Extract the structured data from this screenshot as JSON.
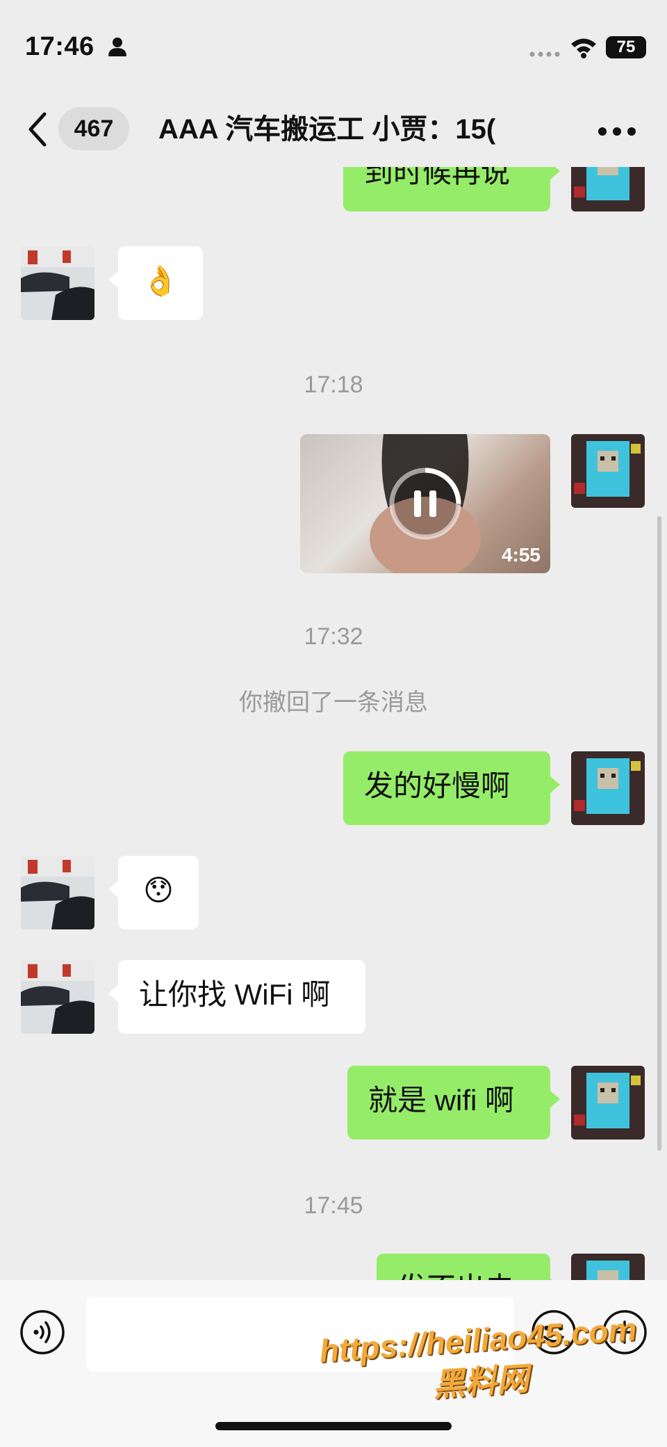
{
  "status_bar": {
    "time": "17:46",
    "battery": "75"
  },
  "nav": {
    "unread_count": "467",
    "title": "AAA 汽车搬运工 小贾：15("
  },
  "messages": {
    "m1_text": "到时候再说",
    "m2_emoji": "👌",
    "ts1": "17:18",
    "video_duration": "4:55",
    "ts2": "17:32",
    "recall_notice": "你撤回了一条消息",
    "m4_text": "发的好慢啊",
    "m5_emoji": "😯",
    "m6_text": "让你找 WiFi 啊",
    "m7_text": "就是 wifi 啊",
    "ts3": "17:45",
    "m8_text": "发不出去"
  },
  "watermark": {
    "line1": "https://heiliao45.com",
    "line2": "黑料网"
  },
  "colors": {
    "my_bubble": "#95ec69",
    "their_bubble": "#ffffff",
    "background": "#ededed",
    "watermark": "#f3a93a"
  }
}
